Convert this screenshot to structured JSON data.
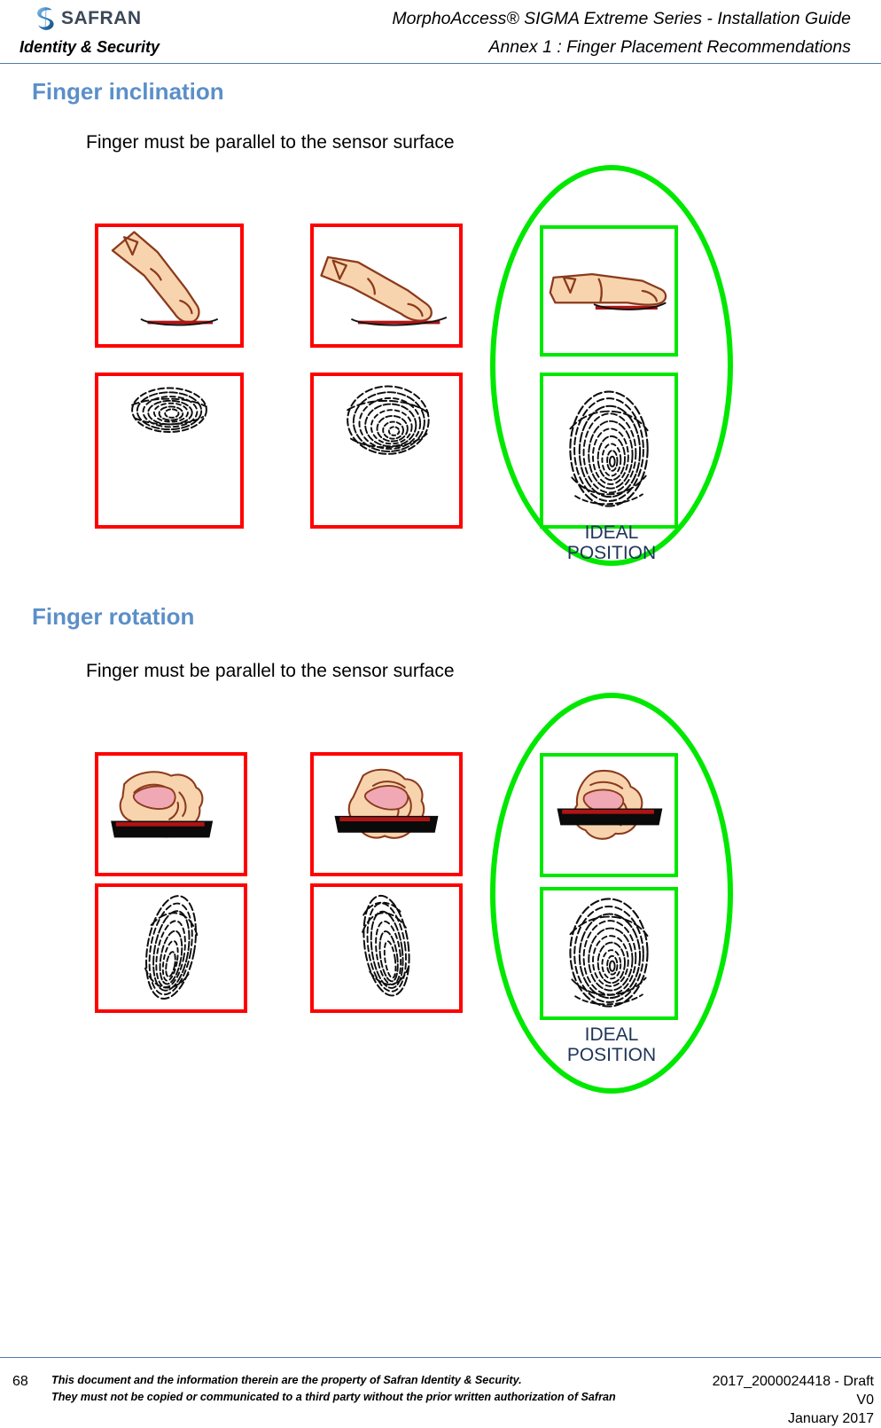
{
  "header": {
    "logo_text": "SAFRAN",
    "logo_icon": "safran-swirl-logo",
    "doc_title": "MorphoAccess® SIGMA Extreme Series - Installation Guide",
    "division": "Identity & Security",
    "annex_title": "Annex 1 : Finger Placement Recommendations"
  },
  "sections": [
    {
      "heading": "Finger inclination",
      "subtitle": "Finger must be parallel to the sensor surface",
      "bad_examples": [
        {
          "pose_caption": "finger-steeply-inclined",
          "print_caption": "small-partial-fingerprint"
        },
        {
          "pose_caption": "finger-slightly-inclined",
          "print_caption": "medium-partial-fingerprint"
        }
      ],
      "ideal": {
        "label": "IDEAL\nPOSITION",
        "pose_caption": "finger-flat-parallel",
        "print_caption": "full-fingerprint"
      }
    },
    {
      "heading": "Finger rotation",
      "subtitle": "Finger must be parallel to the sensor surface",
      "bad_examples": [
        {
          "pose_caption": "finger-rotated-left",
          "print_caption": "narrow-rotated-fingerprint"
        },
        {
          "pose_caption": "finger-rotated-right",
          "print_caption": "narrow-tilted-fingerprint"
        }
      ],
      "ideal": {
        "label": "IDEAL\nPOSITION",
        "pose_caption": "finger-aligned-straight",
        "print_caption": "full-fingerprint"
      }
    }
  ],
  "footer": {
    "page_number": "68",
    "legal_line_1": "This document and the information therein are the property of Safran Identity & Security.",
    "legal_line_2": "They must not be copied or communicated to a third party without the prior written authorization of Safran",
    "reference": "2017_2000024418 - Draft",
    "version": "V0",
    "date": "January 2017"
  },
  "colors": {
    "heading_blue": "#5b8fc9",
    "rule_blue": "#4f7ca8",
    "bad_red": "#fe0000",
    "good_green": "#00e800",
    "caption_navy": "#1f3458",
    "skin": "#f8d4ae",
    "skin_outline": "#8b3a1c",
    "sensor_red": "#b01414"
  }
}
